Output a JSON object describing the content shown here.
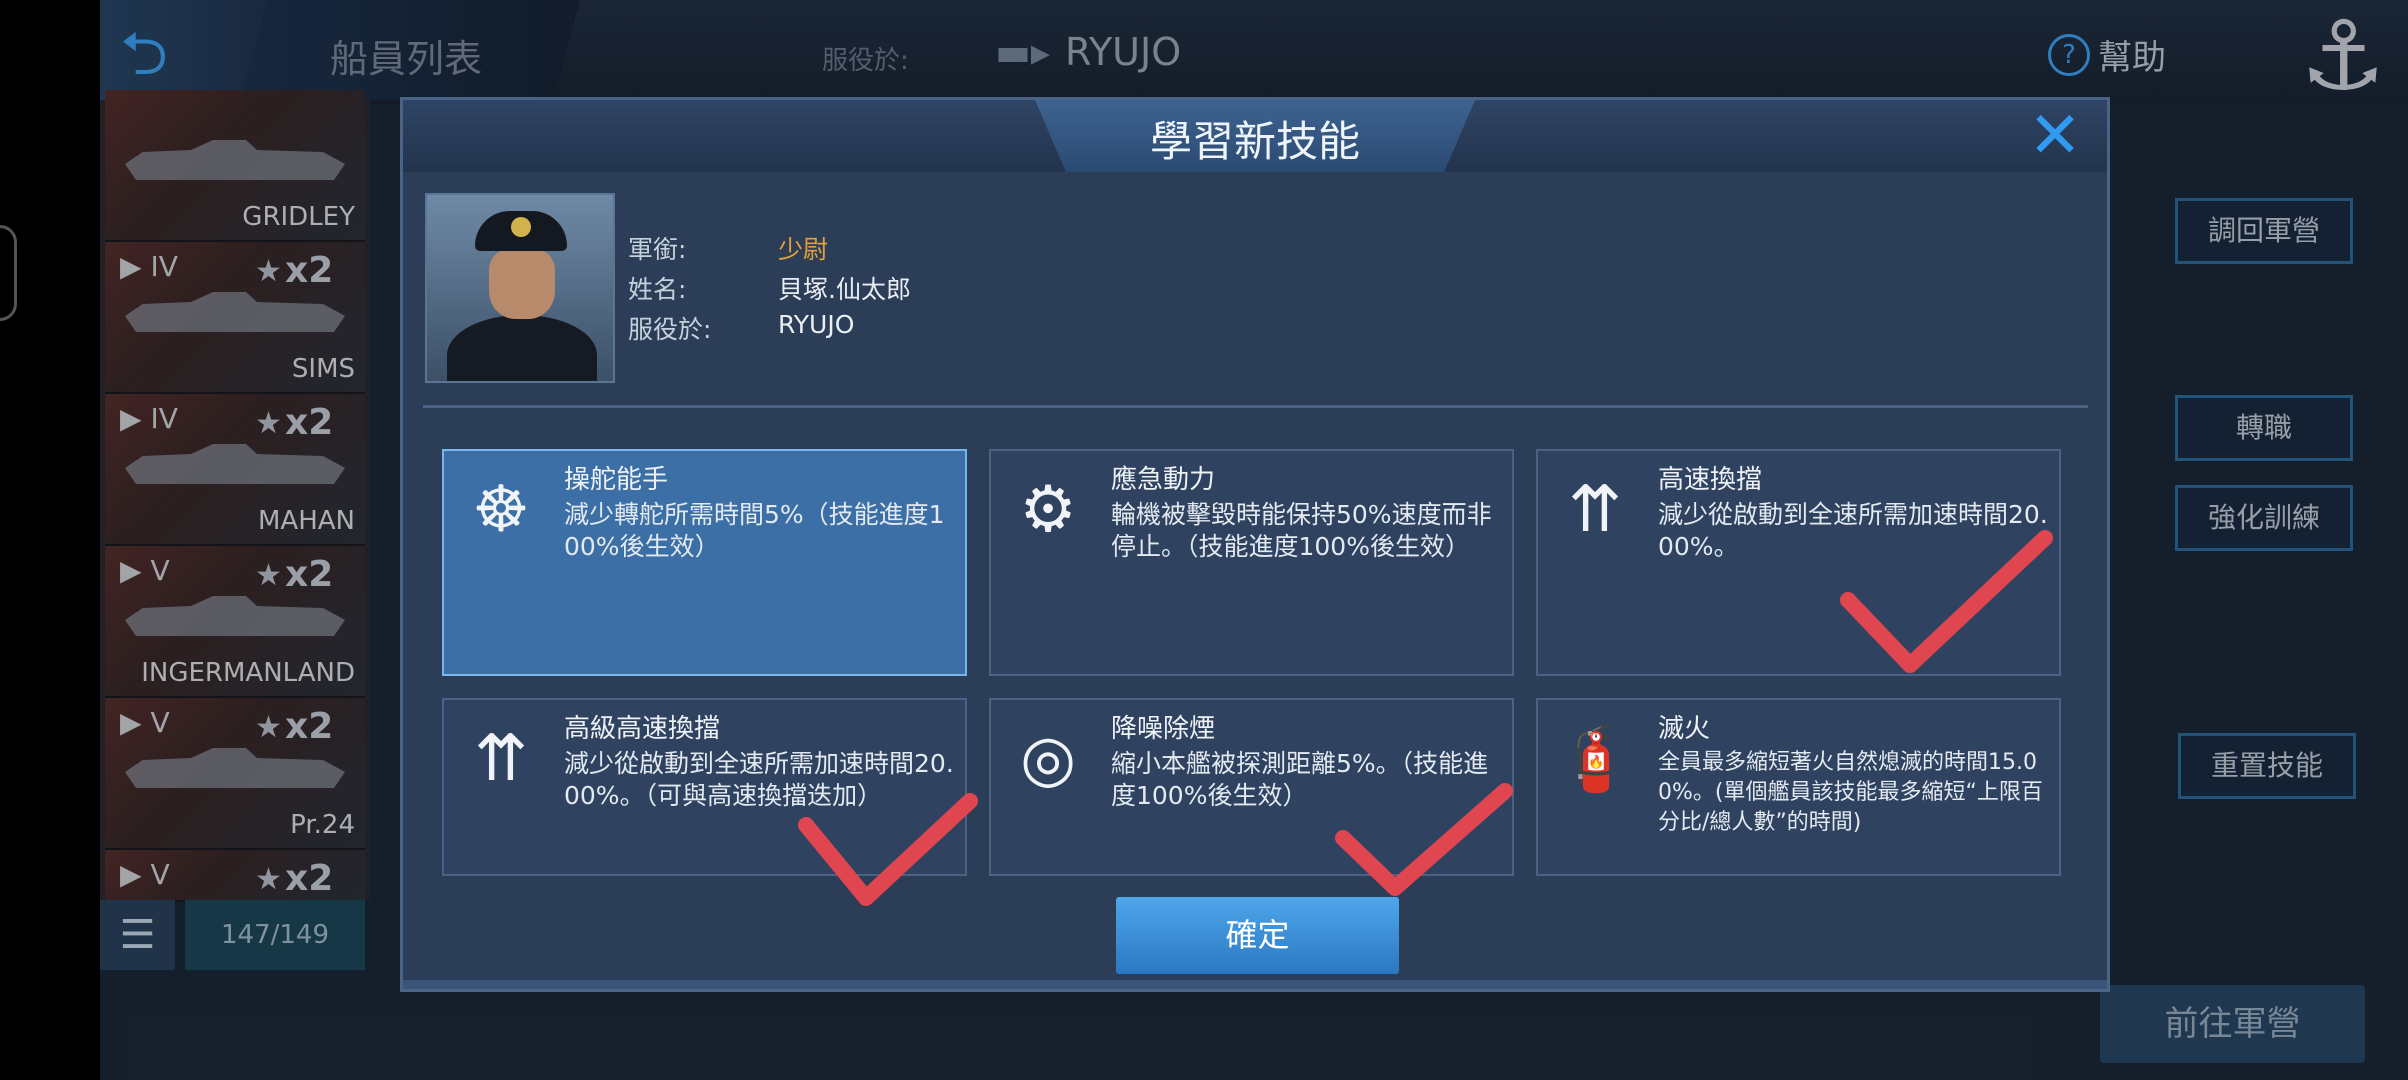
{
  "topbar": {
    "title": "船員列表",
    "service_label": "服役於:",
    "ship_name": "RYUJO",
    "help": "幫助"
  },
  "ship_list": {
    "ships": [
      {
        "tier": "",
        "name": "GRIDLEY",
        "mult": ""
      },
      {
        "tier": "IV",
        "name": "SIMS",
        "mult": "x2"
      },
      {
        "tier": "IV",
        "name": "MAHAN",
        "mult": "x2"
      },
      {
        "tier": "V",
        "name": "INGERMANLAND",
        "mult": "x2"
      },
      {
        "tier": "V",
        "name": "Pr.24",
        "mult": "x2"
      },
      {
        "tier": "V",
        "name": "",
        "mult": "x2"
      }
    ],
    "count": "147/149"
  },
  "right_buttons": {
    "return_camp": "調回軍營",
    "transfer": "轉職",
    "enhance": "強化訓練",
    "reset_skill": "重置技能",
    "go_camp": "前往軍營"
  },
  "modal": {
    "title": "學習新技能",
    "close": "✕",
    "officer": {
      "rank_label": "軍銜:",
      "rank": "少尉",
      "name_label": "姓名:",
      "name": "貝塚.仙太郎",
      "service_label": "服役於:",
      "service": "RYUJO"
    },
    "skills": [
      {
        "name": "操舵能手",
        "desc": "減少轉舵所需時間5%（技能進度100%後生效）",
        "icon": "helm-icon"
      },
      {
        "name": "應急動力",
        "desc": "輪機被擊毀時能保持50%速度而非停止。（技能進度100%後生效）",
        "icon": "gears-icon"
      },
      {
        "name": "高速換擋",
        "desc": "減少從啟動到全速所需加速時間20.00%。",
        "icon": "speed-gauge-icon"
      },
      {
        "name": "高級高速換擋",
        "desc": "減少從啟動到全速所需加速時間20.00%。（可與高速換擋迭加）",
        "icon": "advanced-speed-icon"
      },
      {
        "name": "降噪除煙",
        "desc": "縮小本艦被探測距離5%。（技能進度100%後生效）",
        "icon": "stealth-icon"
      },
      {
        "name": "滅火",
        "desc": "全員最多縮短著火自然熄滅的時間15.00%。(單個艦員該技能最多縮短“上限百分比/總人數”的時間)",
        "icon": "extinguisher-icon"
      }
    ],
    "confirm": "確定"
  },
  "colors": {
    "accent": "#2f9cf2",
    "selected_card": "#3c6fa6",
    "card": "#2f4361",
    "rank": "#e2a13a",
    "checkmark": "#e0464f"
  }
}
